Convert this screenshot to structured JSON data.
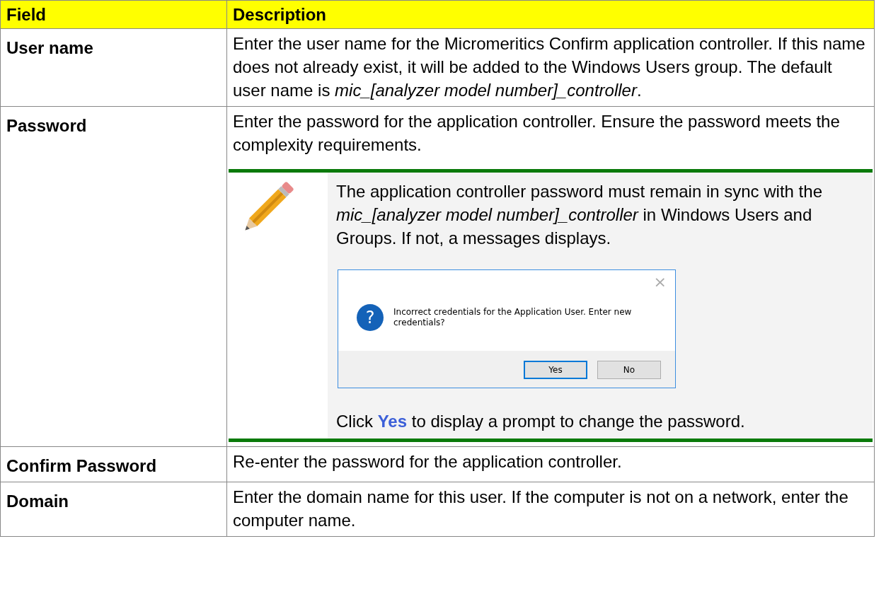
{
  "table": {
    "columns": [
      "Field",
      "Description"
    ],
    "rows": [
      {
        "field": "User name",
        "description": "Enter the user name for the Micromeritics Confirm application controller. If this name does not already exist, it will be added to the Windows Users group. The default user name is *mic_[analyzer model number]_controller*."
      },
      {
        "field": "Password",
        "description": "Enter the password for the application controller. Ensure the password meets the complexity requirements.",
        "note": {
          "text": "The application controller password must remain in sync with the *mic_[analyzer model number]_controller* in Windows Users and Groups. If not, a messages displays.",
          "dialog": {
            "close": "×",
            "icon": "?",
            "message": "Incorrect credentials for the Application User. Enter new credentials?",
            "buttons": [
              {
                "label": "Yes",
                "default": true
              },
              {
                "label": "No",
                "default": false
              }
            ]
          },
          "footer": "Click **Yes** to display a prompt to change the password."
        }
      },
      {
        "field": "Confirm Password",
        "description": "Re-enter the password for the application controller."
      },
      {
        "field": "Domain",
        "description": "Enter the domain name for this user. If the computer is not on a network, enter the computer name."
      }
    ]
  }
}
